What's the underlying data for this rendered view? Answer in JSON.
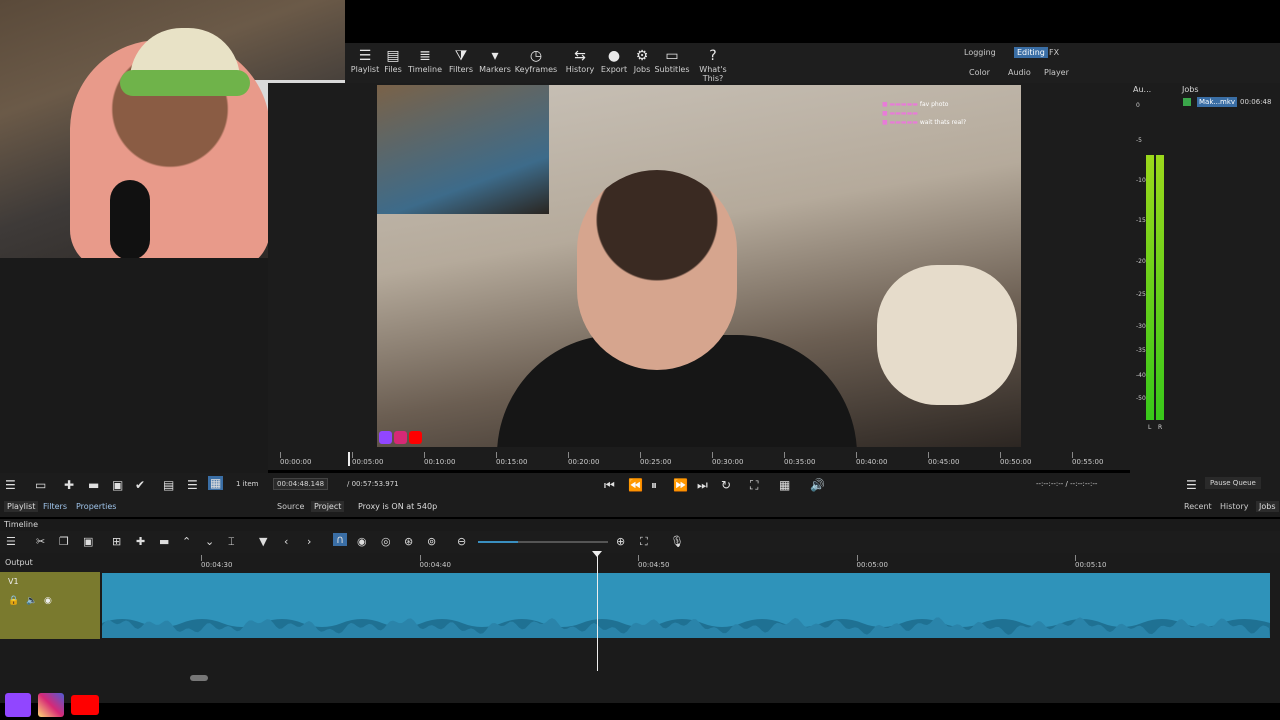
{
  "toolbar": {
    "items": [
      {
        "label": "Playlist",
        "icon": "list-icon",
        "glyph": "☰"
      },
      {
        "label": "Files",
        "icon": "files-icon",
        "glyph": "▤"
      },
      {
        "label": "Timeline",
        "icon": "timeline-icon",
        "glyph": "≣"
      },
      {
        "label": "Filters",
        "icon": "filter-icon",
        "glyph": "⧩"
      },
      {
        "label": "Markers",
        "icon": "marker-icon",
        "glyph": "▾"
      },
      {
        "label": "Keyframes",
        "icon": "stopwatch-icon",
        "glyph": "◷"
      },
      {
        "label": "History",
        "icon": "history-icon",
        "glyph": "⇆"
      },
      {
        "label": "Export",
        "icon": "export-icon",
        "glyph": "●"
      },
      {
        "label": "Jobs",
        "icon": "gear-icon",
        "glyph": "⚙"
      },
      {
        "label": "Subtitles",
        "icon": "subtitles-icon",
        "glyph": "▭"
      },
      {
        "label": "What's This?",
        "icon": "help-icon",
        "glyph": "?"
      }
    ],
    "layouts_top": [
      "Logging",
      "Editing",
      "FX"
    ],
    "layouts_bottom": [
      "Color",
      "Audio",
      "Player"
    ],
    "active_layout": "Editing"
  },
  "player": {
    "chat_lines": [
      "fav photo",
      "",
      "wait thats real?"
    ],
    "ruler_ticks": [
      "00:00:00",
      "00:05:00",
      "00:10:00",
      "00:15:00",
      "00:20:00",
      "00:25:00",
      "00:30:00",
      "00:35:00",
      "00:40:00",
      "00:45:00",
      "00:50:00",
      "00:55:00"
    ],
    "current_time": "00:04:48.148",
    "duration": "/ 00:57:53.971",
    "in_out": "--:--:--:-- / --:--:--:--"
  },
  "audio_meter": {
    "title": "Au...",
    "labels": [
      "0",
      "-5",
      "-10",
      "-15",
      "-20",
      "-25",
      "-30",
      "-35",
      "-40",
      "-50"
    ],
    "channels": [
      "L",
      "R"
    ]
  },
  "jobs": {
    "title": "Jobs",
    "job_name": "Mak...mkv",
    "job_time": "00:06:48",
    "pause_label": "Pause Queue",
    "tabs": [
      "Recent",
      "History",
      "Jobs"
    ]
  },
  "playlist": {
    "count": "1 item",
    "tabs": [
      "Playlist",
      "Filters",
      "Properties"
    ]
  },
  "source_tabs": [
    "Source",
    "Project"
  ],
  "proxy_status": "Proxy is ON at 540p",
  "timeline": {
    "title": "Timeline",
    "output_label": "Output",
    "track_name": "V1",
    "ruler_ticks": [
      "00:04:30",
      "00:04:40",
      "00:04:50",
      "00:05:00",
      "00:05:10"
    ]
  },
  "colors": {
    "accent": "#3a6ea5",
    "clip": "#2f93ba",
    "track_header": "#7a7a2e",
    "meter_green": "#4ccd1f"
  }
}
